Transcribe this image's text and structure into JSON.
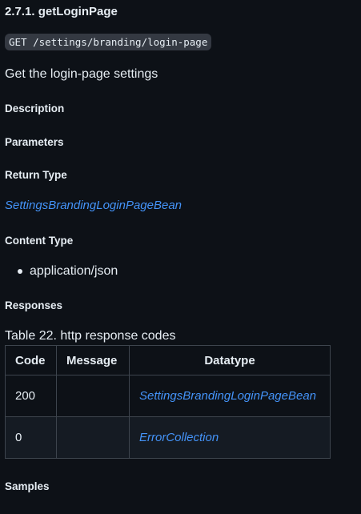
{
  "heading": "2.7.1. getLoginPage",
  "endpoint": "GET /settings/branding/login-page",
  "summary": "Get the login-page settings",
  "sections": {
    "description": "Description",
    "parameters": "Parameters",
    "return_type": "Return Type",
    "content_type": "Content Type",
    "responses": "Responses",
    "samples": "Samples"
  },
  "return_type_value": "SettingsBrandingLoginPageBean",
  "content_types": [
    "application/json"
  ],
  "responses_table": {
    "caption": "Table 22. http response codes",
    "headers": [
      "Code",
      "Message",
      "Datatype"
    ],
    "rows": [
      {
        "code": "200",
        "message": "",
        "datatype": "SettingsBrandingLoginPageBean"
      },
      {
        "code": "0",
        "message": "",
        "datatype": "ErrorCollection"
      }
    ]
  },
  "colors": {
    "background": "#0d1117",
    "text": "#e6edf3",
    "link": "#4493f8",
    "code_bg": "#343942",
    "table_border": "#3d444d",
    "alt_row": "#151b23"
  }
}
